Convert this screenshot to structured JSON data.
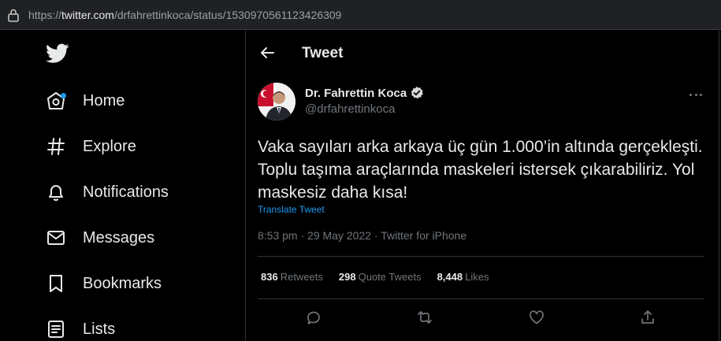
{
  "browser": {
    "url_prefix": "https://",
    "url_host": "twitter.com",
    "url_path": "/drfahrettinkoca/status/1530970561123426309"
  },
  "sidebar": {
    "items": [
      {
        "label": "Home",
        "icon": "home-icon"
      },
      {
        "label": "Explore",
        "icon": "hashtag-icon"
      },
      {
        "label": "Notifications",
        "icon": "bell-icon"
      },
      {
        "label": "Messages",
        "icon": "envelope-icon"
      },
      {
        "label": "Bookmarks",
        "icon": "bookmark-icon"
      },
      {
        "label": "Lists",
        "icon": "list-icon"
      }
    ]
  },
  "header": {
    "title": "Tweet"
  },
  "tweet": {
    "author_name": "Dr. Fahrettin Koca",
    "handle": "@drfahrettinkoca",
    "text": "Vaka sayıları arka arkaya üç gün 1.000’in altında gerçekleşti. Toplu taşıma araçlarında maskeleri istersek çıkarabiliriz. Yol maskesiz daha kısa!",
    "translate_label": "Translate Tweet",
    "time": "8:53 pm · 29 May 2022",
    "separator": " · ",
    "source": "Twitter for iPhone",
    "retweets_count": "836",
    "retweets_label": "Retweets",
    "quotes_count": "298",
    "quotes_label": "Quote Tweets",
    "likes_count": "8,448",
    "likes_label": "Likes"
  },
  "colors": {
    "accent": "#1d9bf0",
    "background": "#000000",
    "text": "#e7e9ea",
    "muted": "#71767b",
    "border": "#2f3336"
  }
}
